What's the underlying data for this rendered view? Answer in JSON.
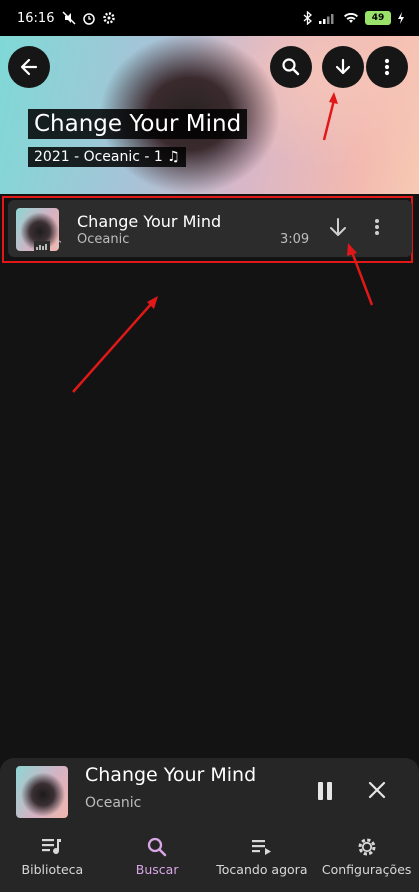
{
  "status_bar": {
    "time": "16:16",
    "battery": "49"
  },
  "album": {
    "title": "Change Your Mind",
    "meta": "2021 - Oceanic - 1 ♫"
  },
  "track": {
    "title": "Change Your Mind",
    "artist": "Oceanic",
    "duration": "3:09"
  },
  "now_playing": {
    "title": "Change Your Mind",
    "artist": "Oceanic"
  },
  "bottom_nav": {
    "items": [
      {
        "label": "Biblioteca",
        "icon": "library-music-icon",
        "active": false
      },
      {
        "label": "Buscar",
        "icon": "search-icon",
        "active": true
      },
      {
        "label": "Tocando agora",
        "icon": "playlist-play-icon",
        "active": false
      },
      {
        "label": "Configurações",
        "icon": "gear-icon",
        "active": false
      }
    ]
  },
  "colors": {
    "background": "#131313",
    "card": "#2c2c2c",
    "highlight_border": "#e01818",
    "annotation_arrow": "#e01818",
    "active_tab": "#d9a6e6"
  }
}
